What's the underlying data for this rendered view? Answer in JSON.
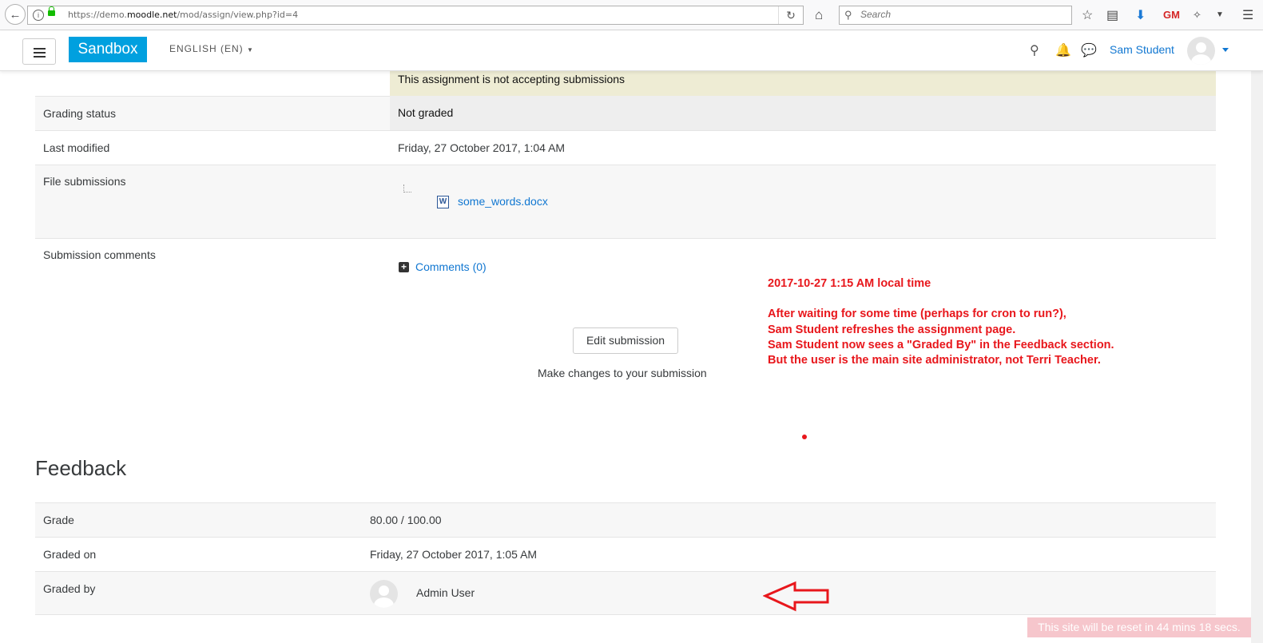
{
  "browser": {
    "url_prefix": "https://demo.",
    "url_domain": "moodle.net",
    "url_path": "/mod/assign/view.php?id=4",
    "search_placeholder": "Search"
  },
  "navbar": {
    "brand": "Sandbox",
    "language": "ENGLISH (EN)",
    "user_name": "Sam Student"
  },
  "submission": {
    "status_message": "This assignment is not accepting submissions",
    "rows": [
      {
        "label": "Grading status",
        "value": "Not graded"
      },
      {
        "label": "Last modified",
        "value": "Friday, 27 October 2017, 1:04 AM"
      },
      {
        "label": "File submissions",
        "file": "some_words.docx"
      },
      {
        "label": "Submission comments",
        "comments": "Comments (0)"
      }
    ],
    "edit_button": "Edit submission",
    "edit_hint": "Make changes to your submission"
  },
  "feedback": {
    "heading": "Feedback",
    "rows": [
      {
        "label": "Grade",
        "value": "80.00 / 100.00"
      },
      {
        "label": "Graded on",
        "value": "Friday, 27 October 2017, 1:05 AM"
      },
      {
        "label": "Graded by",
        "value": "Admin User"
      }
    ]
  },
  "annotation": {
    "line1": "2017-10-27 1:15 AM local time",
    "line2": "After waiting for some time (perhaps for cron to run?),",
    "line3": "Sam Student refreshes the assignment page.",
    "line4": "Sam Student now sees a \"Graded By\" in the Feedback section.",
    "line5": "But the user is the main site administrator, not Terri Teacher.",
    "color": "#e8171c"
  },
  "reset_notice": "This site will be reset in 44 mins 18 secs.",
  "colors": {
    "brand": "#00a0df",
    "link": "#1177d1",
    "status_bg": "#eeecd4"
  }
}
